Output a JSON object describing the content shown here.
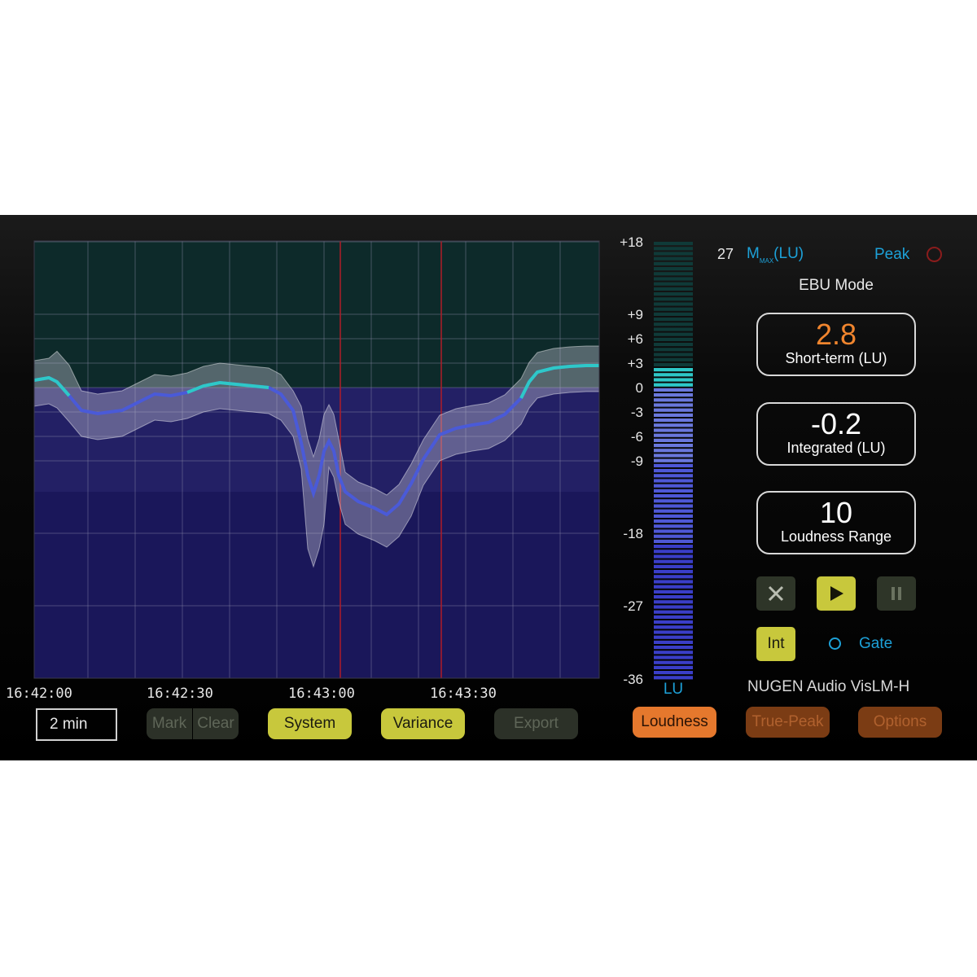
{
  "graph": {
    "y_ticks": [
      "+18",
      "+9",
      "+6",
      "+3",
      "0",
      "-3",
      "-6",
      "-9",
      "-18",
      "-27",
      "-36"
    ],
    "time_labels": [
      "16:42:00",
      "16:42:30",
      "16:43:00",
      "16:43:30"
    ]
  },
  "meter": {
    "unit": "LU",
    "level_lu": 3
  },
  "header": {
    "max_value": "27",
    "max_label_m": "M",
    "max_label_sub": "MAX",
    "max_label_unit": "(LU)",
    "peak_label": "Peak",
    "mode": "EBU Mode"
  },
  "readouts": {
    "short_term": {
      "value": "2.8",
      "label": "Short-term (LU)"
    },
    "integrated": {
      "value": "-0.2",
      "label": "Integrated (LU)"
    },
    "range": {
      "value": "10",
      "label": "Loudness Range"
    }
  },
  "controls": {
    "int_label": "Int",
    "gate_label": "Gate"
  },
  "product_name": "NUGEN Audio VisLM-H",
  "toolbar": {
    "timespan": "2 min",
    "mark": "Mark",
    "clear": "Clear",
    "system": "System",
    "variance": "Variance",
    "export": "Export",
    "loudness": "Loudness",
    "true_peak": "True-Peak",
    "options": "Options"
  },
  "colors": {
    "accent_cyan": "#2ec8c8",
    "accent_blue": "#1da1d8",
    "orange": "#e5782d",
    "yellow": "#c8c83c"
  }
}
